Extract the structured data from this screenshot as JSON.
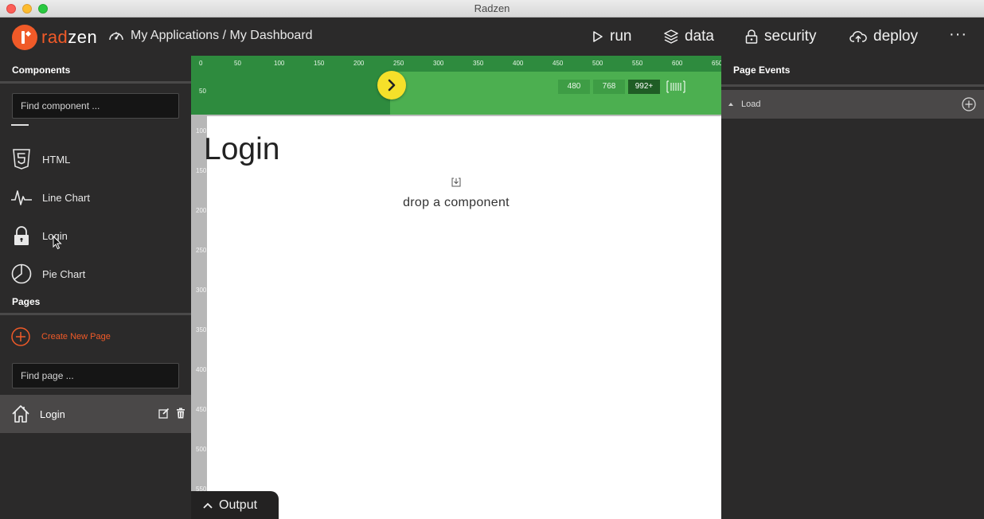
{
  "window": {
    "title": "Radzen"
  },
  "brand": {
    "logo_part1": "rad",
    "logo_part2": "zen"
  },
  "breadcrumb": {
    "text": "My Applications / My Dashboard"
  },
  "topmenu": {
    "run": "run",
    "data": "data",
    "security": "security",
    "deploy": "deploy",
    "more": "···"
  },
  "components": {
    "header": "Components",
    "search_placeholder": "Find component ...",
    "items": [
      {
        "label": "HTML",
        "icon": "html5-icon"
      },
      {
        "label": "Line Chart",
        "icon": "line-chart-icon"
      },
      {
        "label": "Login",
        "icon": "lock-icon"
      },
      {
        "label": "Pie Chart",
        "icon": "pie-chart-icon"
      }
    ]
  },
  "pages": {
    "header": "Pages",
    "create_label": "Create New Page",
    "search_placeholder": "Find page ...",
    "items": [
      {
        "label": "Login",
        "icon": "home-icon",
        "selected": true
      }
    ]
  },
  "canvas": {
    "ruler_h": [
      "0",
      "50",
      "100",
      "150",
      "200",
      "250",
      "300",
      "350",
      "400",
      "450",
      "500",
      "550",
      "600",
      "650"
    ],
    "ruler_v": [
      "50",
      "100",
      "150",
      "200",
      "250",
      "300",
      "350",
      "400",
      "450",
      "500",
      "550"
    ],
    "breakpoints": [
      "480",
      "768",
      "992+"
    ],
    "active_breakpoint": "992+",
    "page_title": "Login",
    "drop_text": "drop a component",
    "accent_green": "#4caf50",
    "toggle_color": "#f5e02a"
  },
  "output": {
    "label": "Output"
  },
  "page_events": {
    "header": "Page Events",
    "items": [
      {
        "label": "Load"
      }
    ]
  },
  "colors": {
    "brand": "#f05a28",
    "panel_bg": "#2b2a2a",
    "selected_bg": "#4a4848"
  }
}
